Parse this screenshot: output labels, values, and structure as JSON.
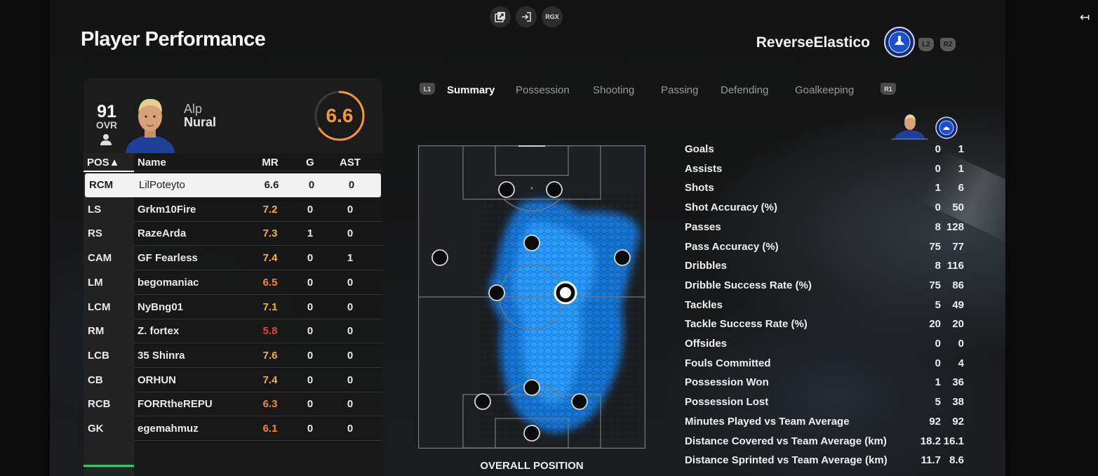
{
  "top_buttons": [
    {
      "icon": "share-screen-icon",
      "label": ""
    },
    {
      "icon": "enter-icon",
      "label": ""
    },
    {
      "icon": "rgx-icon",
      "label": "RGX"
    }
  ],
  "page_title": "Player Performance",
  "team": {
    "name": "ReverseElastico",
    "badge": "chelsea-badge",
    "hint_left": "L2",
    "hint_right": "R2"
  },
  "player": {
    "ovr": "91",
    "ovr_label": "OVR",
    "first_name": "Alp",
    "last_name": "Nural",
    "match_rating": "6.6",
    "rating_fraction": 0.66
  },
  "table": {
    "headers": {
      "pos": "POS▲",
      "name": "Name",
      "mr": "MR",
      "g": "G",
      "ast": "AST"
    },
    "rows": [
      {
        "pos": "RCM",
        "name": "LilPoteyto",
        "mr": "6.6",
        "g": "0",
        "ast": "0",
        "selected": true,
        "mr_color": "#222222"
      },
      {
        "pos": "LS",
        "name": "Grkm10Fire",
        "mr": "7.2",
        "g": "0",
        "ast": "0",
        "mr_color": "#f2b233"
      },
      {
        "pos": "RS",
        "name": "RazeArda",
        "mr": "7.3",
        "g": "1",
        "ast": "0",
        "mr_color": "#f2b233"
      },
      {
        "pos": "CAM",
        "name": "GF Fearless",
        "mr": "7.4",
        "g": "0",
        "ast": "1",
        "mr_color": "#f2b233"
      },
      {
        "pos": "LM",
        "name": "begomaniac",
        "mr": "6.5",
        "g": "0",
        "ast": "0",
        "mr_color": "#f28a2e"
      },
      {
        "pos": "LCM",
        "name": "NyBng01",
        "mr": "7.1",
        "g": "0",
        "ast": "0",
        "mr_color": "#f2b233"
      },
      {
        "pos": "RM",
        "name": "Z. fortex",
        "mr": "5.8",
        "g": "0",
        "ast": "0",
        "mr_color": "#e8452e"
      },
      {
        "pos": "LCB",
        "name": "35 Shinra",
        "mr": "7.6",
        "g": "0",
        "ast": "0",
        "mr_color": "#f2b233"
      },
      {
        "pos": "CB",
        "name": "ORHUN",
        "mr": "7.4",
        "g": "0",
        "ast": "0",
        "mr_color": "#f2b233"
      },
      {
        "pos": "RCB",
        "name": "FORRtheREPU",
        "mr": "6.3",
        "g": "0",
        "ast": "0",
        "mr_color": "#f28a2e"
      },
      {
        "pos": "GK",
        "name": "egemahmuz",
        "mr": "6.1",
        "g": "0",
        "ast": "0",
        "mr_color": "#f28a2e"
      }
    ]
  },
  "tabs": {
    "hint_left": "L1",
    "hint_right": "R1",
    "items": [
      "Summary",
      "Possession",
      "Shooting",
      "Passing",
      "Defending",
      "Goalkeeping"
    ],
    "active": "Summary"
  },
  "pitch": {
    "caption": "OVERALL POSITION",
    "heatmap_color": "#1f8fff"
  },
  "stats": [
    {
      "label": "Goals",
      "player": "0",
      "team": "1"
    },
    {
      "label": "Assists",
      "player": "0",
      "team": "1"
    },
    {
      "label": "Shots",
      "player": "1",
      "team": "6"
    },
    {
      "label": "Shot Accuracy (%)",
      "player": "0",
      "team": "50"
    },
    {
      "label": "Passes",
      "player": "8",
      "team": "128"
    },
    {
      "label": "Pass Accuracy (%)",
      "player": "75",
      "team": "77"
    },
    {
      "label": "Dribbles",
      "player": "8",
      "team": "116"
    },
    {
      "label": "Dribble Success Rate (%)",
      "player": "75",
      "team": "86"
    },
    {
      "label": "Tackles",
      "player": "5",
      "team": "49"
    },
    {
      "label": "Tackle Success Rate (%)",
      "player": "20",
      "team": "20"
    },
    {
      "label": "Offsides",
      "player": "0",
      "team": "0"
    },
    {
      "label": "Fouls Committed",
      "player": "0",
      "team": "4"
    },
    {
      "label": "Possession Won",
      "player": "1",
      "team": "36"
    },
    {
      "label": "Possession Lost",
      "player": "5",
      "team": "38"
    },
    {
      "label": "Minutes Played vs Team Average",
      "player": "92",
      "team": "92"
    },
    {
      "label": "Distance Covered vs Team Average (km)",
      "player": "18.2",
      "team": "16.1"
    },
    {
      "label": "Distance Sprinted vs Team Average (km)",
      "player": "11.7",
      "team": "8.6"
    }
  ],
  "icons": {
    "exit": "exit-icon",
    "person": "person-icon"
  }
}
